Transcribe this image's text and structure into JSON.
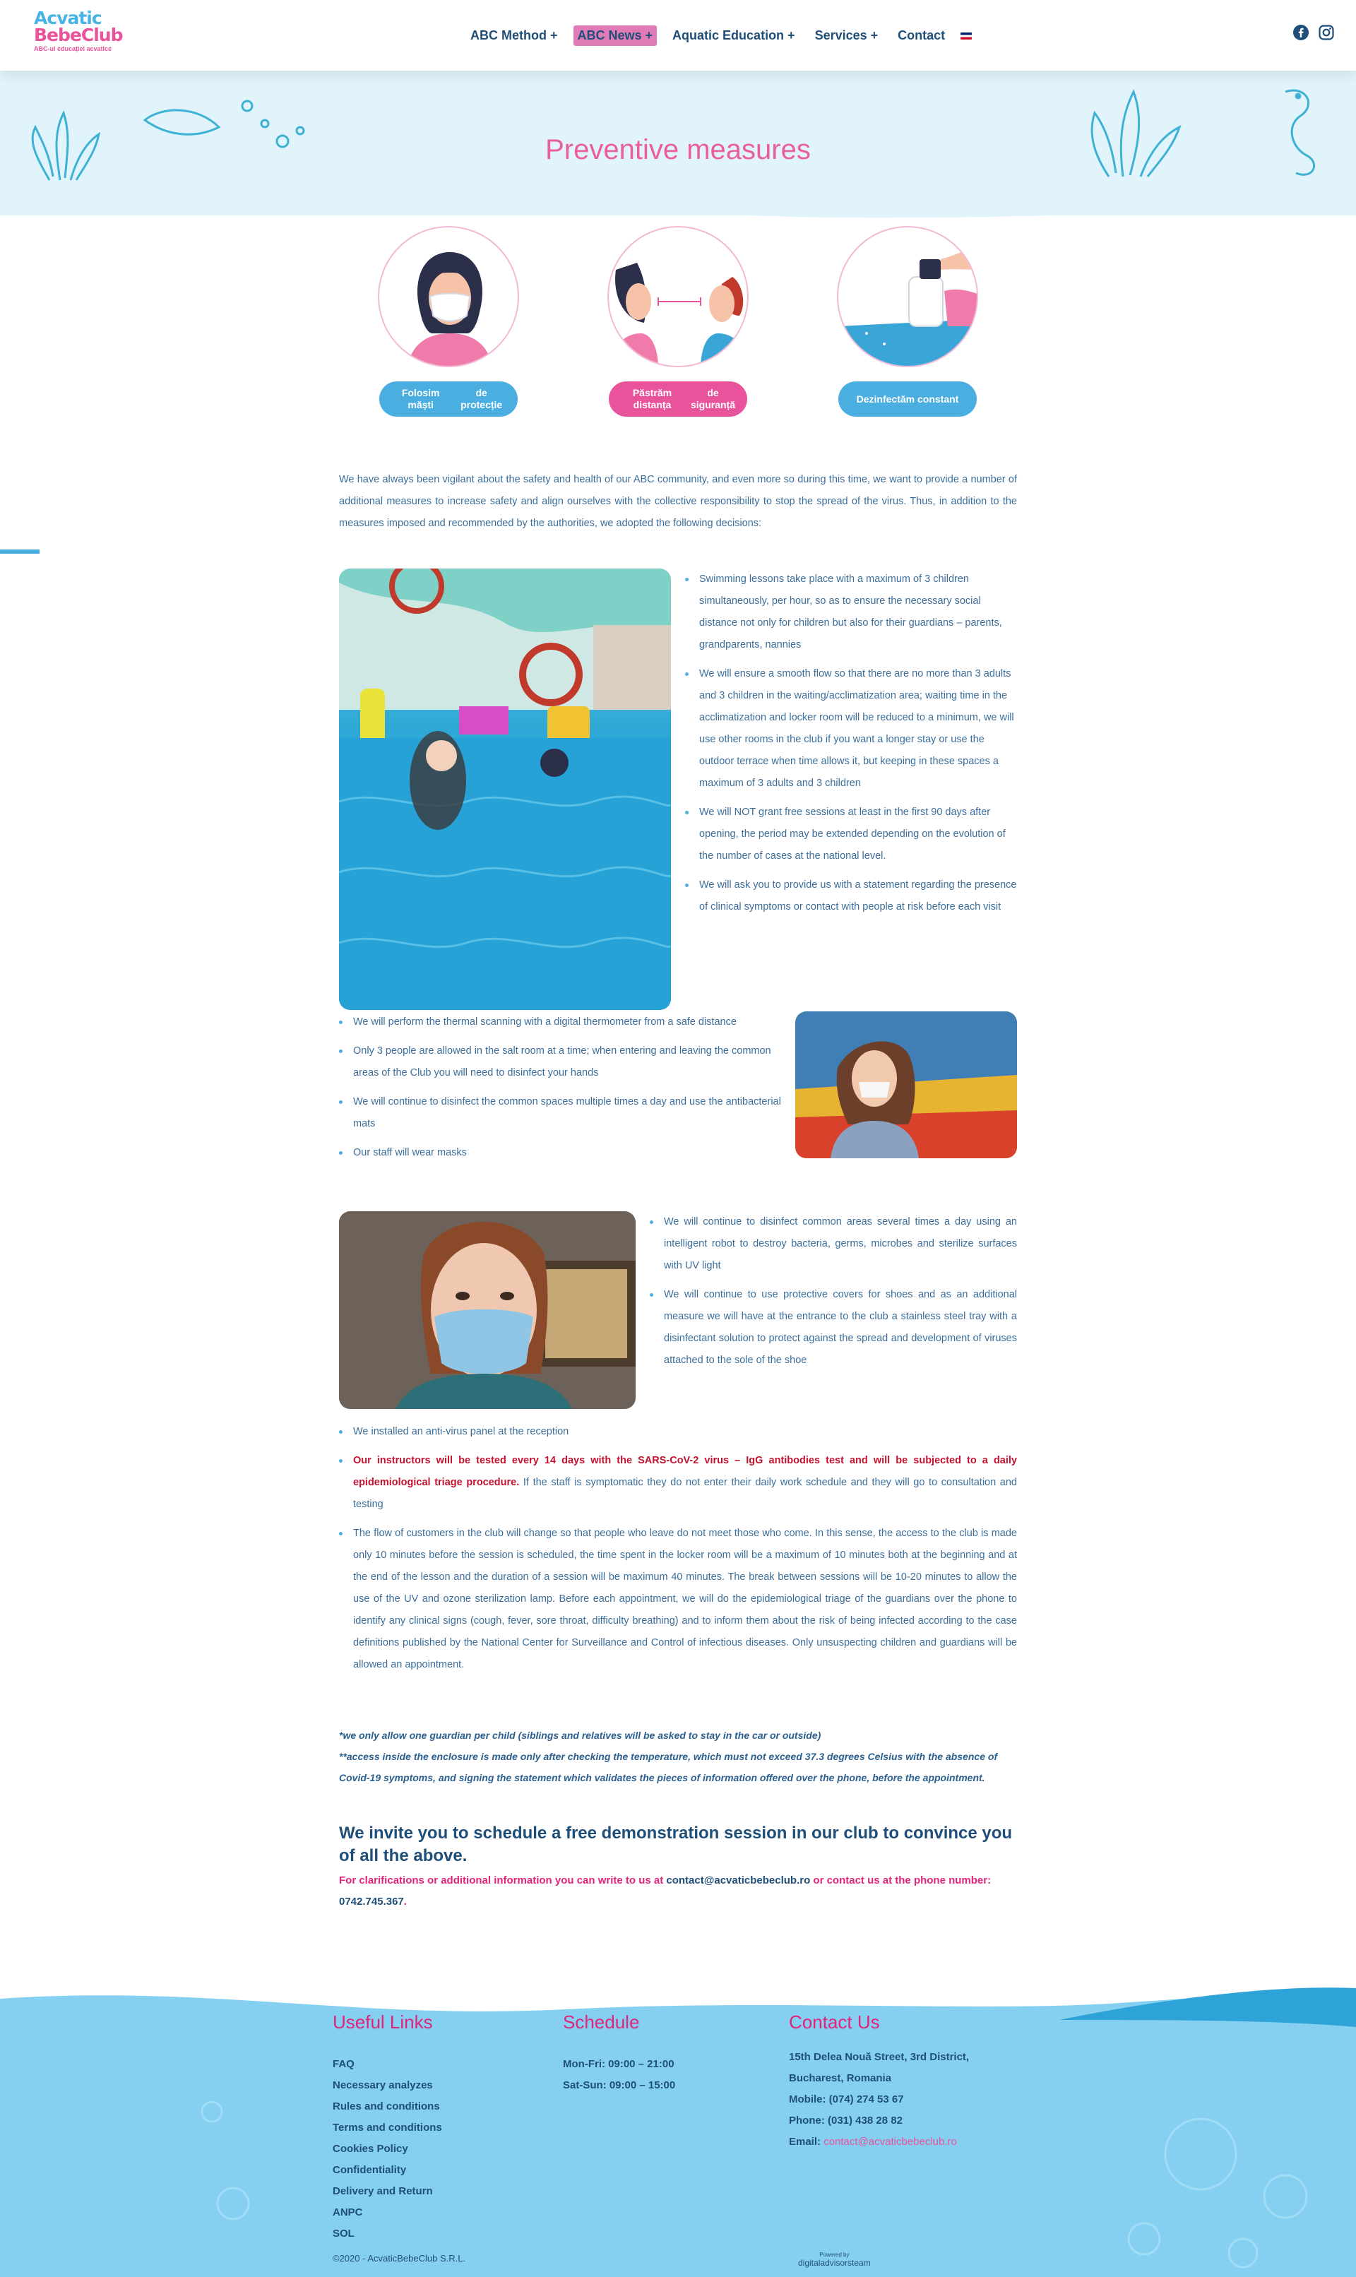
{
  "header": {
    "logo_top": "Acvatic",
    "logo_bottom": "BebeClub",
    "logo_sub": "ABC-ul educației acvatice",
    "nav": [
      {
        "label": "ABC Method +",
        "active": false
      },
      {
        "label": "ABC News +",
        "active": true
      },
      {
        "label": "Aquatic Education +",
        "active": false
      },
      {
        "label": "Services +",
        "active": false
      },
      {
        "label": "Contact",
        "active": false
      }
    ],
    "social_icons": [
      "facebook-icon",
      "instagram-icon"
    ]
  },
  "hero": {
    "title": "Preventive measures"
  },
  "badges": [
    {
      "label_line1": "Folosim măști",
      "label_line2": "de protecție",
      "color": "#4aafe0"
    },
    {
      "label_line1": "Păstrăm distanța",
      "label_line2": "de siguranță",
      "color": "#e9539b"
    },
    {
      "label_line1": "Dezinfectăm constant",
      "label_line2": "",
      "color": "#4aafe0"
    }
  ],
  "intro": "We have always been vigilant about the safety and health of our ABC community, and even more so during this time, we want to provide a number of additional measures to increase safety and align ourselves with the collective responsibility to stop the spread of the virus. Thus, in addition to the measures imposed and recommended by the authorities, we adopted the following decisions:",
  "block1": [
    "Swimming lessons take place with a maximum of 3 children simultaneously, per hour, so as to ensure the necessary social distance not only for children but also for their guardians – parents, grandparents, nannies",
    "We will ensure a smooth flow so that there are no more than 3 adults and 3 children in the waiting/acclimatization area; waiting time in the acclimatization and locker room will be reduced to a minimum, we will use other rooms in the club if you want a longer stay or use the outdoor terrace when time allows it, but keeping in these spaces a maximum of 3 adults and 3 children",
    "We will NOT grant free sessions at least in the first 90 days after opening, the period may be extended depending on the evolution of the number of cases at the national level.",
    "We will ask you to provide us with a statement regarding the presence of clinical symptoms or contact with people at risk before each visit"
  ],
  "block2": [
    "We will perform the thermal scanning with a digital thermometer from a safe distance",
    "Only 3 people are allowed in the salt room at a time; when entering and leaving the common areas of the Club you will need to disinfect your hands",
    "We will continue to disinfect the common spaces multiple times a day and use the antibacterial mats",
    "Our staff will wear masks"
  ],
  "block3": [
    "We will continue to disinfect common areas several times a day using an intelligent robot to destroy bacteria, germs, microbes and sterilize surfaces with UV light",
    "We will continue to use protective covers for shoes and as an additional measure we will have at the entrance to the club a stainless steel tray with a disinfectant solution to protect against the spread and development of viruses attached to the sole of the shoe"
  ],
  "block4": {
    "antivirus": "We installed an anti-virus panel at the reception",
    "tested_red": "Our instructors will be tested every 14 days with the SARS-CoV-2 virus – IgG antibodies test and will be subjected to a daily epidemiological triage procedure.",
    "tested_rest": " If the staff is symptomatic they do not enter their daily work schedule and they will go to consultation and testing",
    "flow": "The flow of customers in the club will change so that people who leave do not meet those who come. In this sense, the access to the club is made only 10 minutes before the session is scheduled, the time spent in the locker room will be a maximum of 10 minutes both at the beginning and at the end of the lesson and the duration of a session will be maximum 40 minutes. The break between sessions will be 10-20 minutes to allow the use of the UV and ozone sterilization lamp. Before each appointment, we will do the epidemiological triage of the guardians over the phone to identify any clinical signs (cough, fever, sore throat, difficulty breathing) and to inform them about the risk of being infected according to the case definitions published by the National Center for Surveillance and Control of infectious diseases. Only unsuspecting children and guardians will be allowed an appointment."
  },
  "notes": {
    "line1": "*we only allow one guardian per child (siblings and relatives will be asked to stay in the car or outside)",
    "line2": "**access inside the enclosure is made only after checking the temperature, which must not exceed 37.3 degrees Celsius with the absence of Covid-19 symptoms, and signing the statement which validates the pieces of information offered over the phone, before the appointment."
  },
  "invite": "We invite you to schedule a free demonstration session in our club to convince you of all the above.",
  "clarification": {
    "prefix": "For clarifications or additional information you can write to us at ",
    "email": "contact@acvaticbebeclub.ro",
    "middle": " or contact us at the phone number: ",
    "phone": "0742.745.367",
    "suffix": "."
  },
  "footer": {
    "useful_title": "Useful Links",
    "useful_links": [
      "FAQ",
      "Necessary analyzes",
      "Rules and conditions",
      "Terms and conditions",
      "Cookies Policy",
      "Confidentiality",
      "Delivery and Return",
      "ANPC",
      "SOL"
    ],
    "schedule_title": "Schedule",
    "schedule": [
      "Mon-Fri: 09:00 – 21:00",
      "Sat-Sun: 09:00 – 15:00"
    ],
    "contact_title": "Contact Us",
    "contact_lines": [
      "15th Delea Nouă Street, 3rd District,",
      "Bucharest, Romania",
      "Mobile: (074) 274 53 67",
      "Phone: (031) 438 28 82"
    ],
    "email_label": "Email: ",
    "email_value": "contact@acvaticbebeclub.ro",
    "copyright": "©2020 - AcvaticBebeClub S.R.L.",
    "credit_small": "Powered by",
    "credit": "digitaladvisorsteam"
  },
  "colors": {
    "pink": "#e9539b",
    "blue": "#4aafe0",
    "navy": "#1f4e79",
    "footer_bg": "#7fcef0"
  }
}
